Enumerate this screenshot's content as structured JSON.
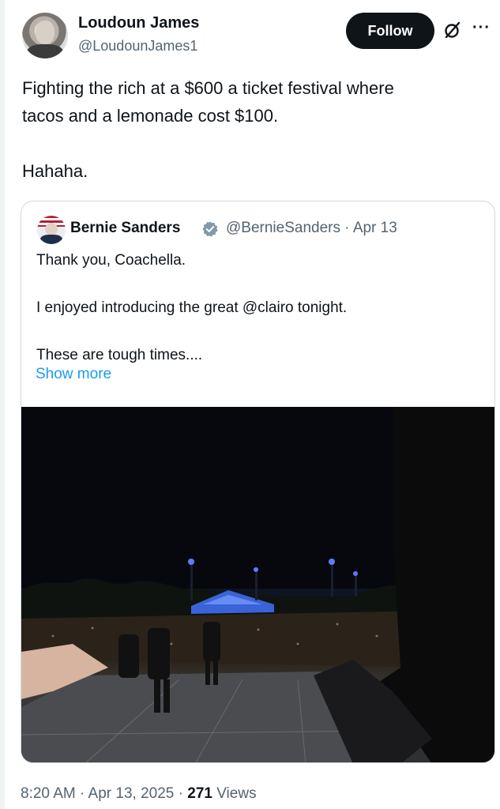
{
  "author": {
    "name": "Loudoun James",
    "handle": "@LoudounJames1",
    "follow_label": "Follow"
  },
  "tweet": {
    "text": "Fighting the rich at a $600 a ticket festival where\ntacos and a lemonade cost $100.\n\nHahaha."
  },
  "quote": {
    "name": "Bernie Sanders",
    "handle": "@BernieSanders",
    "date": "Apr 13",
    "meta": "@BernieSanders · Apr 13",
    "text": "Thank you, Coachella.\n\nI enjoyed introducing the great @clairo tonight.\n\nThese are tough times....",
    "show_more": "Show more"
  },
  "footer": {
    "time": "8:20 AM",
    "date": "Apr 13, 2025",
    "prefix": "8:20 AM · Apr 13, 2025 · ",
    "views_count": "271",
    "views_label": " Views"
  },
  "icons": {
    "grok": "grok-icon",
    "more": "more-icon",
    "verified": "verified-badge-icon"
  },
  "colors": {
    "accent": "#1d9bf0",
    "text": "#0f1419",
    "secondary": "#536471",
    "border": "#cfd9de",
    "follow_bg": "#0f1419"
  }
}
